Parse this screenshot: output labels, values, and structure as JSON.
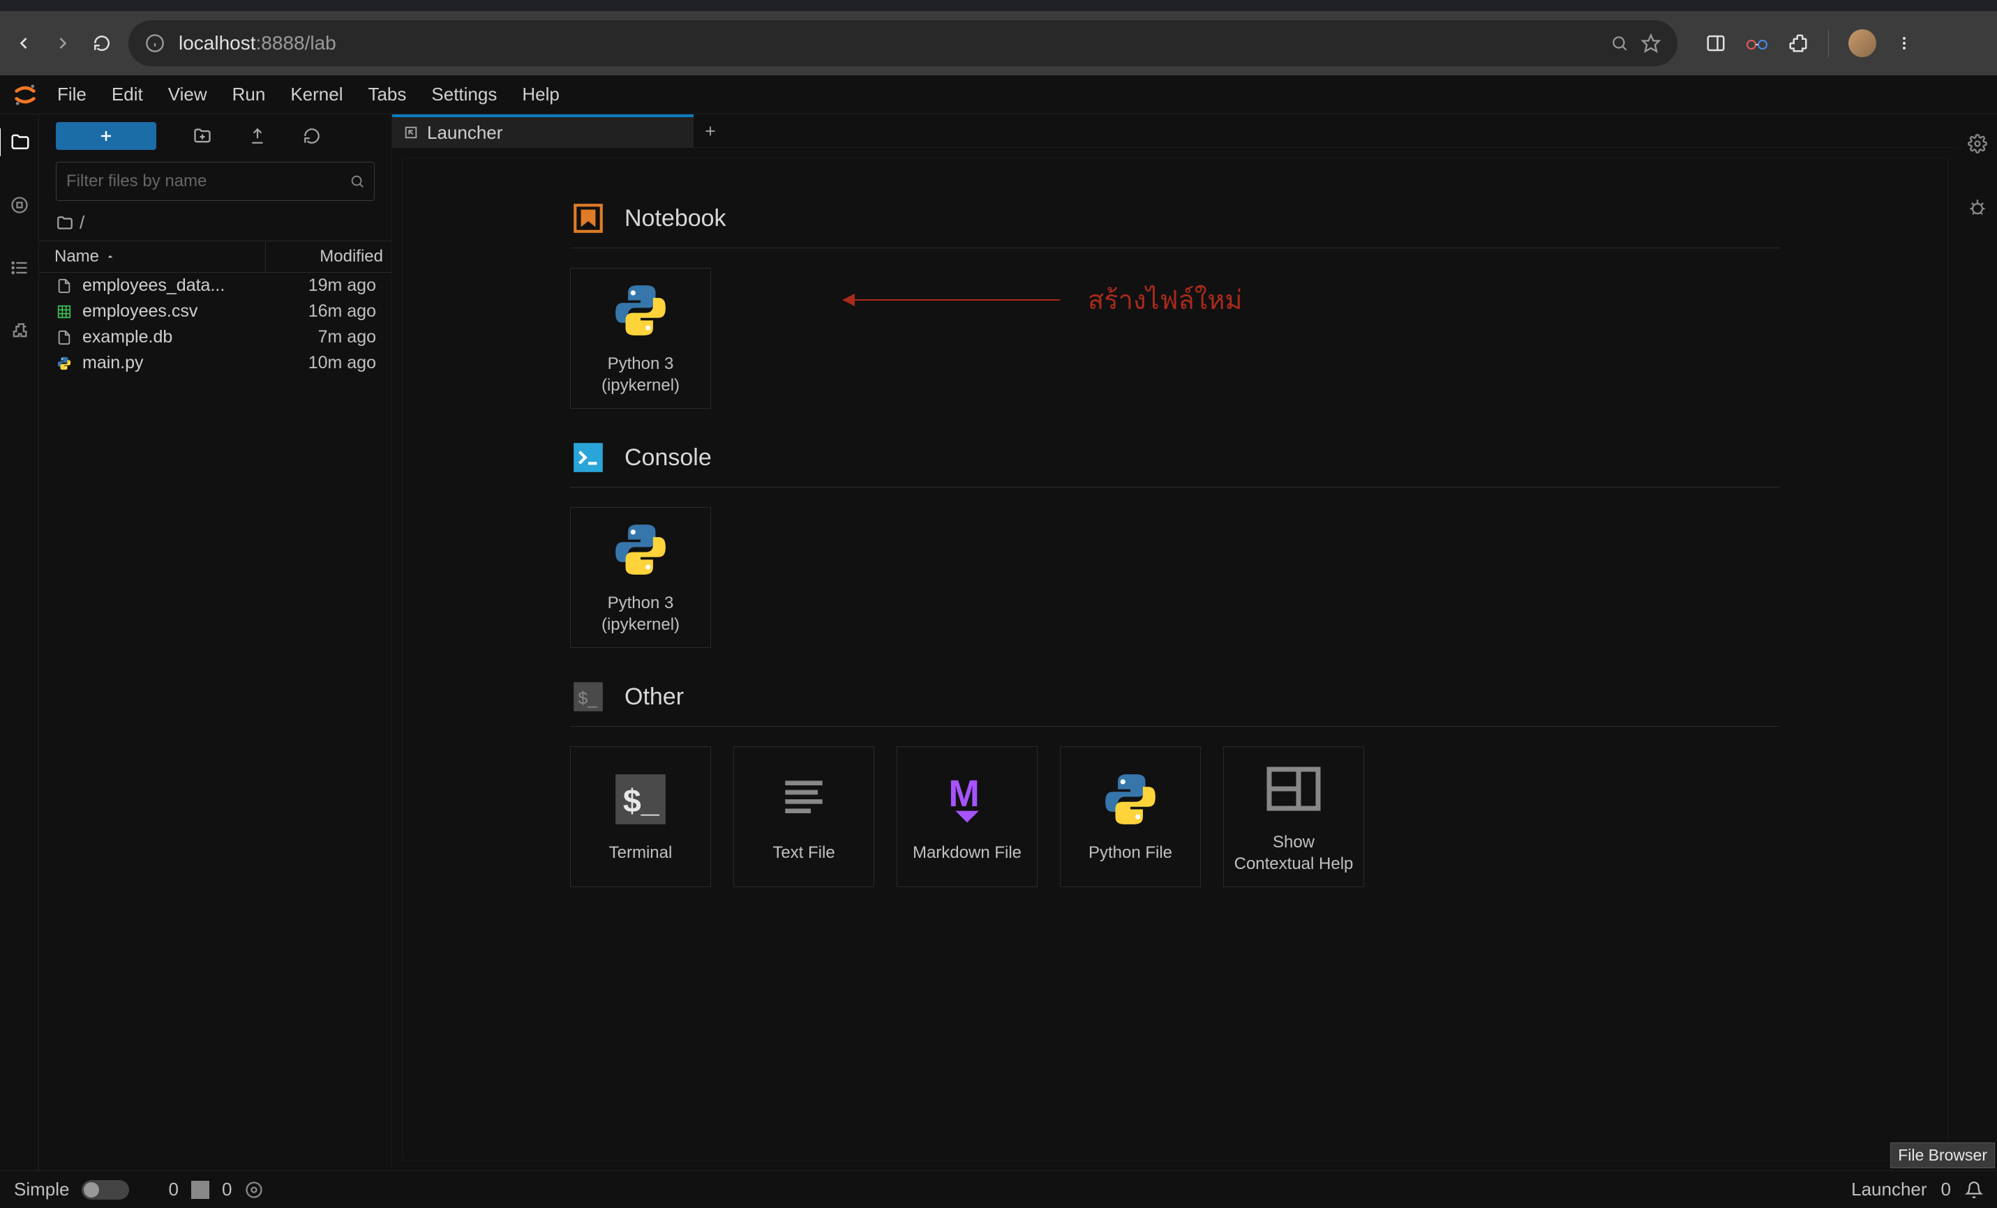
{
  "browser": {
    "url_host": "localhost",
    "url_path": ":8888/lab"
  },
  "menubar": {
    "items": [
      "File",
      "Edit",
      "View",
      "Run",
      "Kernel",
      "Tabs",
      "Settings",
      "Help"
    ]
  },
  "sidebar": {
    "filter_placeholder": "Filter files by name",
    "breadcrumb": "/",
    "columns": {
      "name": "Name",
      "modified": "Modified"
    },
    "files": [
      {
        "icon": "file",
        "name": "employees_data...",
        "modified": "19m ago"
      },
      {
        "icon": "csv",
        "name": "employees.csv",
        "modified": "16m ago"
      },
      {
        "icon": "file",
        "name": "example.db",
        "modified": "7m ago"
      },
      {
        "icon": "python",
        "name": "main.py",
        "modified": "10m ago"
      }
    ]
  },
  "tab": {
    "label": "Launcher"
  },
  "launcher": {
    "sections": {
      "notebook": {
        "title": "Notebook",
        "cards": [
          {
            "label": "Python 3 (ipykernel)"
          }
        ]
      },
      "console": {
        "title": "Console",
        "cards": [
          {
            "label": "Python 3 (ipykernel)"
          }
        ]
      },
      "other": {
        "title": "Other",
        "cards": [
          {
            "label": "Terminal"
          },
          {
            "label": "Text File"
          },
          {
            "label": "Markdown File"
          },
          {
            "label": "Python File"
          },
          {
            "label": "Show Contextual Help"
          }
        ]
      }
    }
  },
  "annotation": {
    "text": "สร้างไฟล์ใหม่"
  },
  "statusbar": {
    "simple": "Simple",
    "zero_a": "0",
    "zero_b": "0",
    "launcher": "Launcher",
    "zero_right": "0"
  },
  "tooltip": "File Browser",
  "colors": {
    "accent": "#0a7bbf",
    "new_btn": "#1b6da7",
    "annotation": "#a82a1a",
    "notebook_icon": "#e07b27",
    "console_icon": "#2aa5d8",
    "csv_green": "#3fb84f",
    "markdown": "#a754ff"
  }
}
